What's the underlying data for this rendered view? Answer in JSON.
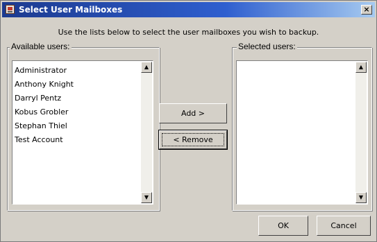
{
  "window": {
    "title": "Select User Mailboxes",
    "close_glyph": "×"
  },
  "instruction": "Use the lists below to select the user mailboxes you wish to backup.",
  "available": {
    "label": "Available users:",
    "items": [
      "Administrator",
      "Anthony Knight",
      "Darryl Pentz",
      "Kobus Grobler",
      "Stephan Thiel",
      "Test Account"
    ]
  },
  "selected": {
    "label": "Selected users:",
    "items": []
  },
  "buttons": {
    "add": "Add >",
    "remove": "< Remove",
    "ok": "OK",
    "cancel": "Cancel"
  },
  "scroll": {
    "up_glyph": "▲",
    "down_glyph": "▼"
  },
  "icons": {
    "app": "mailbox-app-icon",
    "close": "close-icon",
    "scroll_up": "scroll-up-arrow-icon",
    "scroll_down": "scroll-down-arrow-icon"
  },
  "colors": {
    "titlebar_start": "#1c3a8f",
    "titlebar_end": "#a6caf0",
    "dialog_bg": "#d4d0c8"
  }
}
